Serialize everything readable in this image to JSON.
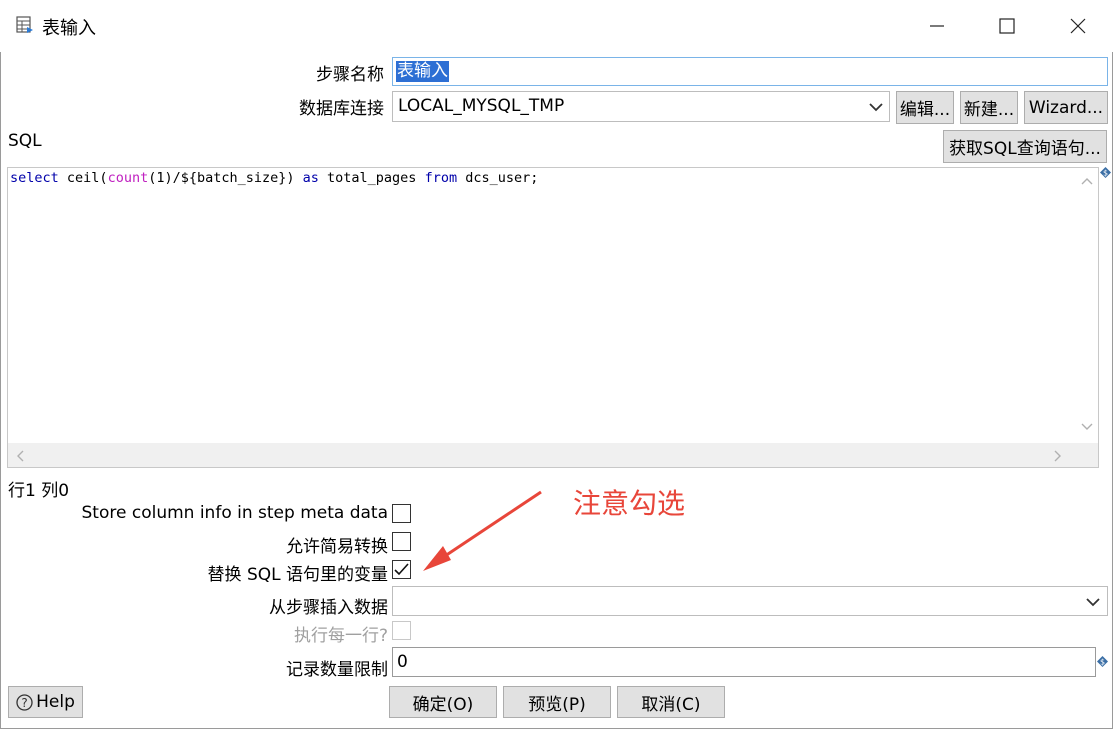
{
  "window": {
    "title": "表输入",
    "minimize_icon": "minimize-icon",
    "maximize_icon": "maximize-icon",
    "close_icon": "close-icon"
  },
  "form": {
    "step_name_label": "步骤名称",
    "step_name_value": "表输入",
    "db_conn_label": "数据库连接",
    "db_conn_value": "LOCAL_MYSQL_TMP",
    "edit_button": "编辑...",
    "new_button": "新建...",
    "wizard_button": "Wizard...",
    "sql_label": "SQL",
    "get_sql_button": "获取SQL查询语句...",
    "sql_tokens": [
      {
        "t": "select",
        "c": "kw"
      },
      {
        "t": " ceil(",
        "c": ""
      },
      {
        "t": "count",
        "c": "fn"
      },
      {
        "t": "(1)/${batch_size}) ",
        "c": ""
      },
      {
        "t": "as",
        "c": "kw"
      },
      {
        "t": " total_pages ",
        "c": ""
      },
      {
        "t": "from",
        "c": "kw"
      },
      {
        "t": " dcs_user;",
        "c": ""
      }
    ],
    "cursor_status": "行1 列0",
    "store_column_label": "Store column info in step meta data",
    "store_column_checked": false,
    "lazy_conversion_label": "允许简易转换",
    "lazy_conversion_checked": false,
    "replace_vars_label": "替换 SQL 语句里的变量",
    "replace_vars_checked": true,
    "insert_from_step_label": "从步骤插入数据",
    "insert_from_step_value": "",
    "execute_each_row_label": "执行每一行?",
    "execute_each_row_checked": false,
    "limit_label": "记录数量限制",
    "limit_value": "0"
  },
  "annotation": {
    "text": "注意勾选",
    "color": "#e8463a"
  },
  "footer": {
    "help_button": "Help",
    "ok_button": "确定(O)",
    "preview_button": "预览(P)",
    "cancel_button": "取消(C)"
  }
}
